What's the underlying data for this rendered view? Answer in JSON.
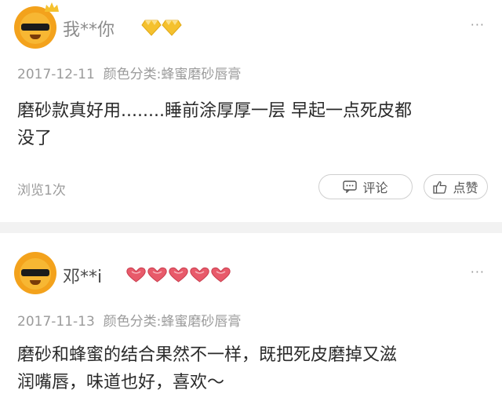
{
  "reviews": [
    {
      "username": "我**你",
      "badge_icon": "diamond-icon",
      "badge_count": 2,
      "more": "···",
      "date": "2017-12-11",
      "variant": "颜色分类:蜂蜜磨砂唇膏",
      "content_line1": "磨砂款真好用........睡前涂厚厚一层 早起一点死皮都",
      "content_line2": "没了",
      "views": "浏览1次",
      "comment_label": "评论",
      "like_label": "点赞"
    },
    {
      "username": "邓**i",
      "badge_icon": "heart-icon",
      "badge_count": 5,
      "more": "···",
      "date": "2017-11-13",
      "variant": "颜色分类:蜂蜜磨砂唇膏",
      "content_line1": "磨砂和蜂蜜的结合果然不一样，既把死皮磨掉又滋",
      "content_line2": "润嘴唇，味道也好，喜欢～"
    }
  ],
  "colors": {
    "diamond": "#f5c12e",
    "heart": "#e85a6a",
    "avatar": "#f3a21c"
  }
}
